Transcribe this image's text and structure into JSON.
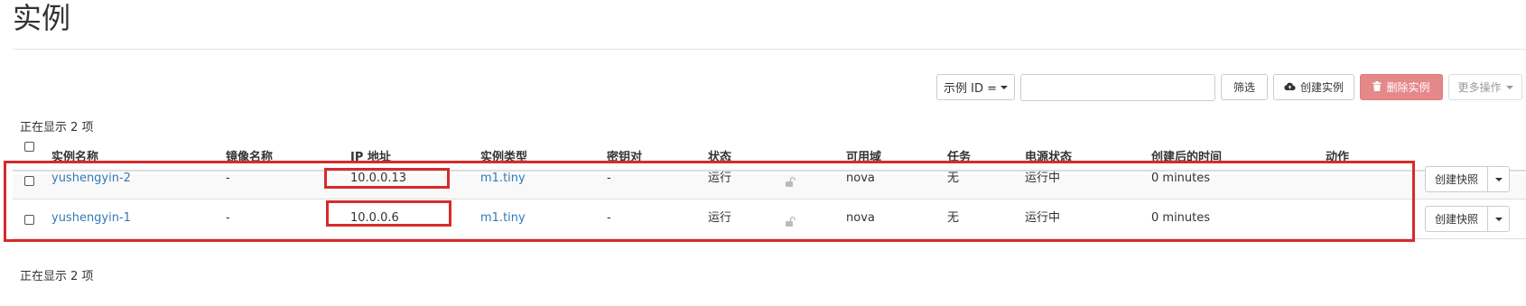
{
  "page": {
    "title": "实例"
  },
  "toolbar": {
    "filter_field": "示例 ID =",
    "filter_value": "",
    "filter_button": "筛选",
    "create_button": "创建实例",
    "delete_button": "删除实例",
    "more_button": "更多操作"
  },
  "summary": {
    "top": "正在显示 2 项",
    "bottom": "正在显示 2 项"
  },
  "table": {
    "headers": {
      "name": "实例名称",
      "image": "镜像名称",
      "ip": "IP 地址",
      "flavor": "实例类型",
      "keypair": "密钥对",
      "status": "状态",
      "az": "可用域",
      "task": "任务",
      "power": "电源状态",
      "age": "创建后的时间",
      "actions": "动作"
    },
    "rows": [
      {
        "name": "yushengyin-2",
        "image": "-",
        "ip": "10.0.0.13",
        "flavor": "m1.tiny",
        "keypair": "-",
        "status": "运行",
        "az": "nova",
        "task": "无",
        "power": "运行中",
        "age": "0 minutes",
        "action": "创建快照"
      },
      {
        "name": "yushengyin-1",
        "image": "-",
        "ip": "10.0.0.6",
        "flavor": "m1.tiny",
        "keypair": "-",
        "status": "运行",
        "az": "nova",
        "task": "无",
        "power": "运行中",
        "age": "0 minutes",
        "action": "创建快照"
      }
    ]
  },
  "colors": {
    "link": "#337ab7",
    "danger": "#e5888a",
    "highlight": "#d62b2b"
  },
  "icons": {
    "create": "cloud-upload-icon",
    "delete": "trash-icon",
    "locked": "unlock-icon"
  }
}
